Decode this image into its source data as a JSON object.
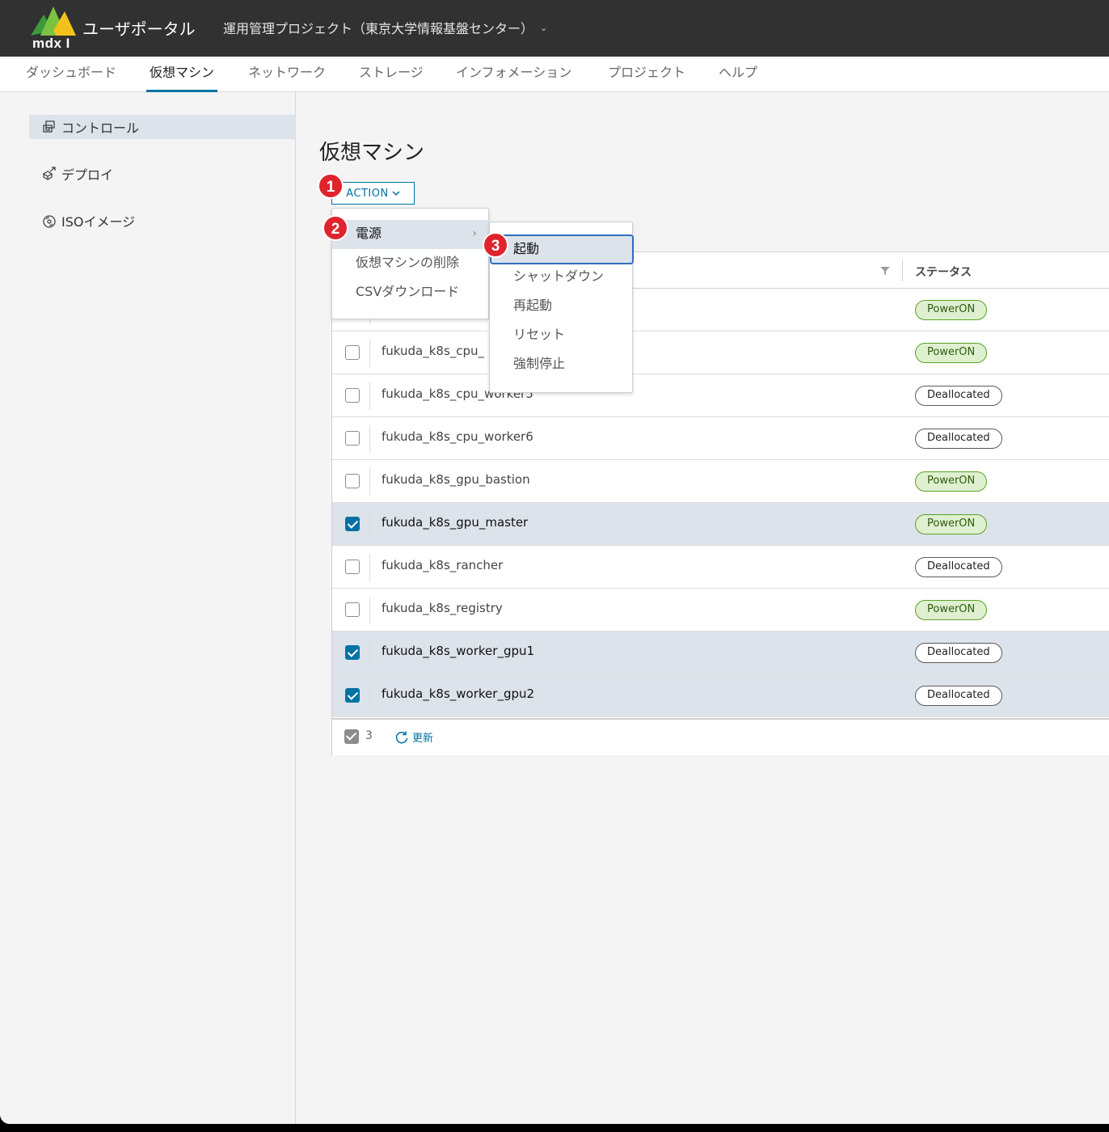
{
  "header": {
    "logo_text": "mdx I",
    "app_title": "ユーザポータル",
    "project": "運用管理プロジェクト（東京大学情報基盤センター）"
  },
  "nav": {
    "tabs": [
      {
        "label": "ダッシュボード"
      },
      {
        "label": "仮想マシン"
      },
      {
        "label": "ネットワーク"
      },
      {
        "label": "ストレージ"
      },
      {
        "label": "インフォメーション"
      },
      {
        "label": "プロジェクト"
      },
      {
        "label": "ヘルプ"
      }
    ],
    "active": "仮想マシン"
  },
  "sidebar": {
    "items": [
      {
        "label": "コントロール",
        "icon": "control-icon"
      },
      {
        "label": "デプロイ",
        "icon": "deploy-icon"
      },
      {
        "label": "ISOイメージ",
        "icon": "disc-icon"
      }
    ]
  },
  "main": {
    "title": "仮想マシン",
    "action_label": "ACTION"
  },
  "menu": {
    "items": [
      "電源",
      "仮想マシンの削除",
      "CSVダウンロード"
    ],
    "power_submenu": [
      "起動",
      "シャットダウン",
      "再起動",
      "リセット",
      "強制停止"
    ]
  },
  "steps": [
    "1",
    "2",
    "3"
  ],
  "grid": {
    "status_header": "ステータス",
    "rows": [
      {
        "name": "",
        "status": "PowerON",
        "selected": false
      },
      {
        "name": "fukuda_k8s_cpu_",
        "status": "PowerON",
        "selected": false
      },
      {
        "name": "fukuda_k8s_cpu_worker5",
        "status": "Deallocated",
        "selected": false
      },
      {
        "name": "fukuda_k8s_cpu_worker6",
        "status": "Deallocated",
        "selected": false
      },
      {
        "name": "fukuda_k8s_gpu_bastion",
        "status": "PowerON",
        "selected": false
      },
      {
        "name": "fukuda_k8s_gpu_master",
        "status": "PowerON",
        "selected": true
      },
      {
        "name": "fukuda_k8s_rancher",
        "status": "Deallocated",
        "selected": false
      },
      {
        "name": "fukuda_k8s_registry",
        "status": "PowerON",
        "selected": false
      },
      {
        "name": "fukuda_k8s_worker_gpu1",
        "status": "Deallocated",
        "selected": true
      },
      {
        "name": "fukuda_k8s_worker_gpu2",
        "status": "Deallocated",
        "selected": true
      }
    ],
    "footer": {
      "selected_count": "3",
      "refresh_label": "更新"
    }
  },
  "colors": {
    "accent": "#0072a3",
    "header_bg": "#313131",
    "power_on": "#5aa220",
    "step_marker": "#e0242e"
  }
}
